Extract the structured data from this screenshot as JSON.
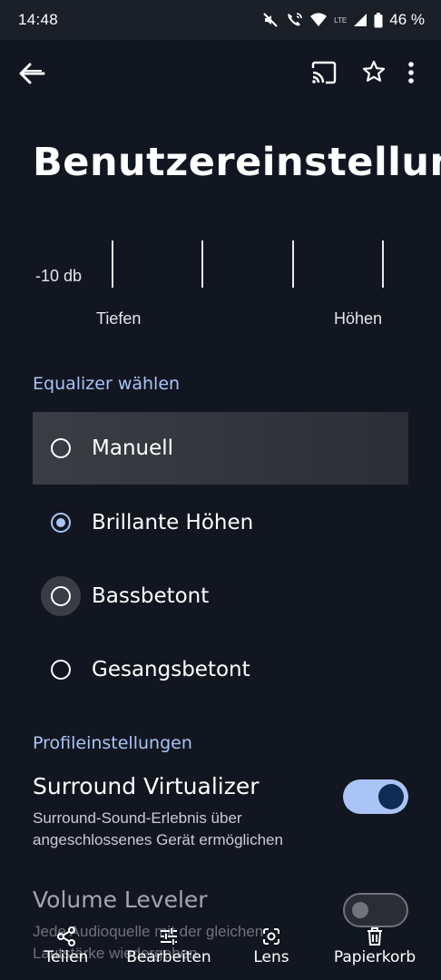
{
  "status_bar": {
    "time": "14:48",
    "battery": "46 %",
    "network": "LTE",
    "icons": [
      "mute-icon",
      "wifi-calling-icon",
      "wifi-icon",
      "signal-icon",
      "battery-icon"
    ]
  },
  "app_bar": {
    "icons": [
      "back-arrow-icon",
      "cast-icon",
      "star-icon",
      "more-vert-icon"
    ]
  },
  "page_title": "Benutzereinstellungen",
  "equalizer_visual": {
    "db_label": "-10 db",
    "low_label": "Tiefen",
    "high_label": "Höhen"
  },
  "equalizer_section": {
    "header": "Equalizer wählen",
    "options": [
      {
        "label": "Manuell",
        "selected": false
      },
      {
        "label": "Brillante Höhen",
        "selected": true
      },
      {
        "label": "Bassbetont",
        "selected": false
      },
      {
        "label": "Gesangsbetont",
        "selected": false
      }
    ]
  },
  "profile_section": {
    "header": "Profileinstellungen",
    "surround": {
      "title": "Surround Virtualizer",
      "description": "Surround-Sound-Erlebnis über angeschlossenes Gerät ermöglichen",
      "enabled": true
    },
    "volume": {
      "title": "Volume Leveler",
      "description": "Jede Audioquelle mit der gleichen Lautstärke wiedergeben",
      "enabled": false
    }
  },
  "bottom_actions": [
    {
      "label": "Teilen",
      "icon": "share-icon"
    },
    {
      "label": "Bearbeiten",
      "icon": "tune-icon"
    },
    {
      "label": "Lens",
      "icon": "lens-icon"
    },
    {
      "label": "Papierkorb",
      "icon": "trash-icon"
    }
  ],
  "colors": {
    "background": "#121620",
    "accent": "#a9c4f5",
    "toggle_knob_on": "#0e2a55"
  }
}
